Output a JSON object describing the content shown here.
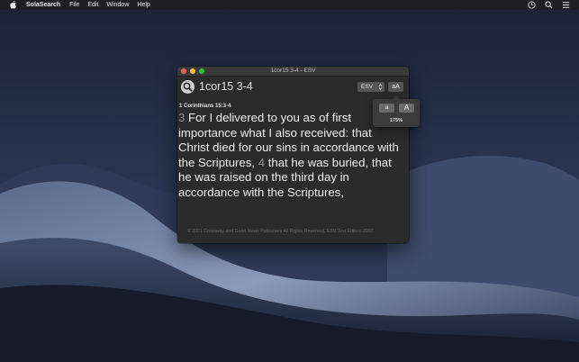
{
  "menubar": {
    "app_name": "SolaSearch",
    "items": [
      "File",
      "Edit",
      "Window",
      "Help"
    ]
  },
  "icons": {
    "apple": "apple-icon",
    "status_clock": "clock-icon",
    "spotlight": "search-icon",
    "control_center": "menu-list-icon",
    "search_button": "magnifier-icon",
    "select_arrows": "up-down-chevron-icon"
  },
  "window": {
    "title": "1cor15 3-4 - ESV",
    "query": "1cor15 3-4",
    "version": "ESV",
    "fontsize_label": "aA",
    "reference": "1 Corinthians 15:3-4",
    "verses": [
      {
        "number": "3",
        "text": " For I delivered to you as of first importance what I also received: that Christ died for our sins in accordance with the Scriptures, "
      },
      {
        "number": "4",
        "text": " that he was buried, that he was raised on the third day in accordance with the Scriptures,"
      }
    ],
    "copyright": "© 2001 Crossway and Good News Publishers All Rights Reserved, ESV Text Edition:2007"
  },
  "popover": {
    "smaller_label": "a",
    "larger_label": "A",
    "zoom_level": "175%"
  },
  "colors": {
    "window_bg": "#2b2b2b",
    "verse_number": "#8a8a8a",
    "close": "#fc5f57",
    "minimize": "#fdbc2e",
    "zoom": "#28c840"
  }
}
